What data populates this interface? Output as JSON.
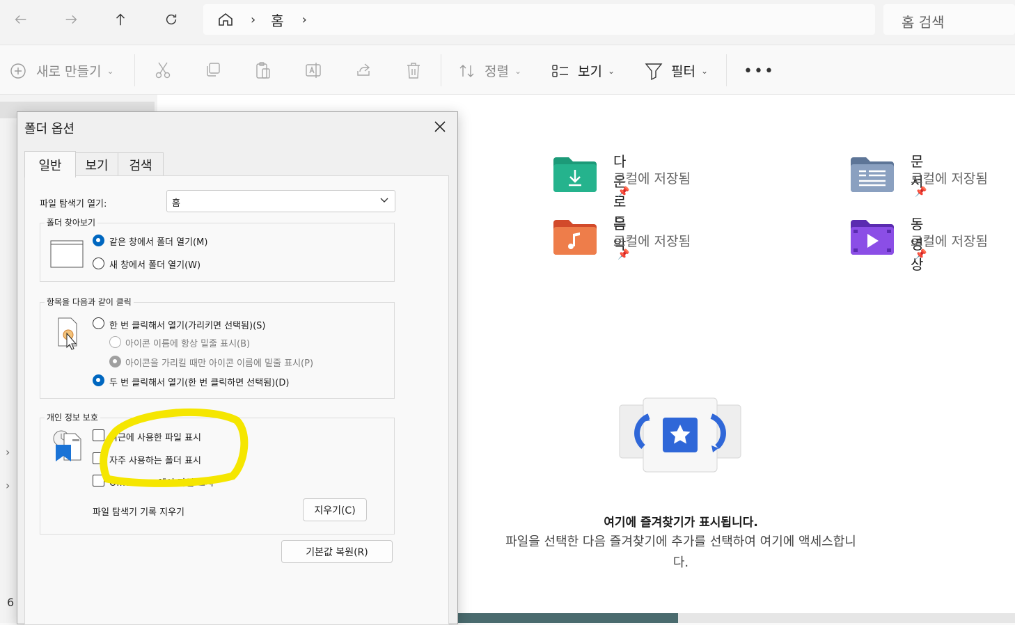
{
  "address": {
    "breadcrumb": [
      "홈"
    ],
    "search_placeholder": "홈 검색"
  },
  "toolbar": {
    "new_label": "새로 만들기",
    "sort_label": "정렬",
    "view_label": "보기",
    "filter_label": "필터"
  },
  "favorites": [
    {
      "name": "다운로드",
      "sub": "로컬에 저장됨",
      "icon": "downloads-folder-icon",
      "color": "#1da17f"
    },
    {
      "name": "문서",
      "sub": "로컬에 저장됨",
      "icon": "documents-folder-icon",
      "color": "#6f86a8"
    },
    {
      "name": "음악",
      "sub": "로컬에 저장됨",
      "icon": "music-folder-icon",
      "color": "#e8633a"
    },
    {
      "name": "동영상",
      "sub": "로컬에 저장됨",
      "icon": "videos-folder-icon",
      "color": "#7a3fd6"
    }
  ],
  "empty_state": {
    "title": "여기에 즐겨찾기가 표시됩니다.",
    "description_line1": "파일을 선택한 다음 즐겨찾기에 추가를 선택하여 여기에 액세스합니",
    "description_line2": "다."
  },
  "left_nav_fragment": "6",
  "dialog": {
    "title": "폴더 옵션",
    "tabs": [
      "일반",
      "보기",
      "검색"
    ],
    "open_explorer_label": "파일 탐색기 열기:",
    "open_explorer_value": "홈",
    "browse_group": {
      "legend": "폴더 찾아보기",
      "options": [
        {
          "label": "같은 창에서 폴더 열기(M)",
          "selected": true
        },
        {
          "label": "새 창에서 폴더 열기(W)",
          "selected": false
        }
      ]
    },
    "click_group": {
      "legend": "항목을 다음과 같이 클릭",
      "single_click": "한 번 클릭해서 열기(가리키면 선택됨)(S)",
      "underline_always": "아이콘 이름에 항상 밑줄 표시(B)",
      "underline_hover": "아이콘을 가리킬 때만 아이콘 이름에 밑줄 표시(P)",
      "double_click": "두 번 클릭해서 열기(한 번 클릭하면 선택됨)(D)"
    },
    "privacy_group": {
      "legend": "개인 정보 보호",
      "recent_files": "최근에 사용한 파일 표시",
      "frequent_folders": "자주 사용하는 폴더 표시",
      "office_files": "Office.com에서 파일 표시",
      "clear_history_label": "파일 탐색기 기록 지우기",
      "clear_button": "지우기(C)"
    },
    "restore_defaults": "기본값 복원(R)"
  },
  "colors": {
    "accent": "#0067c0",
    "highlight": "#f5e600"
  }
}
